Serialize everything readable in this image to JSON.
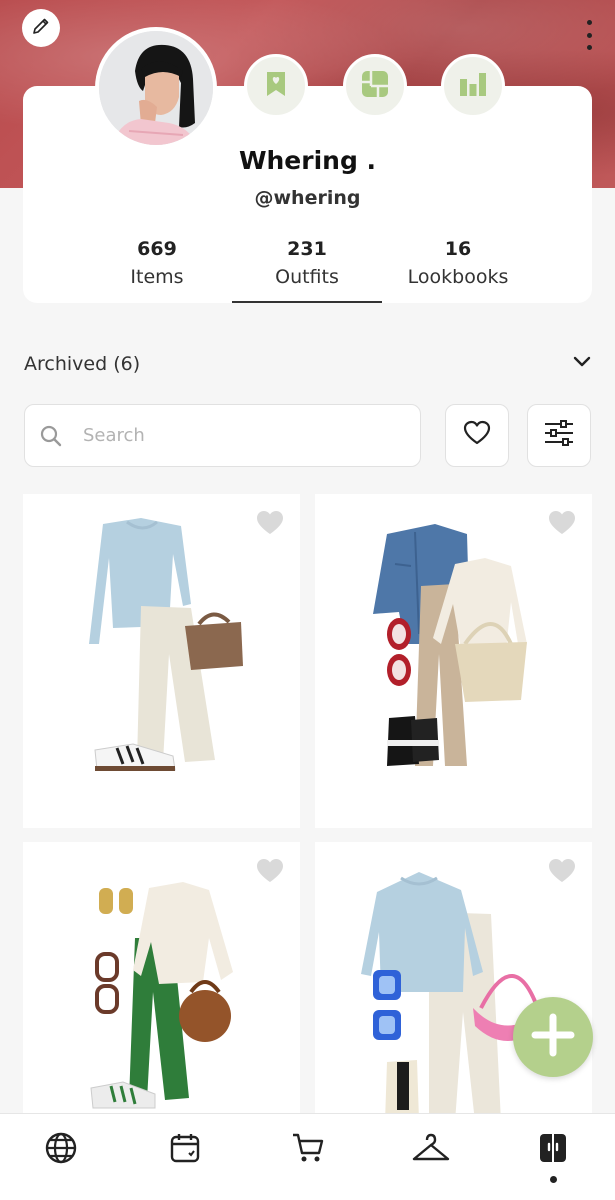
{
  "profile": {
    "name": "Whering  .",
    "handle": "@whering"
  },
  "stats": [
    {
      "count": "669",
      "label": "Items"
    },
    {
      "count": "231",
      "label": "Outfits"
    },
    {
      "count": "16",
      "label": "Lookbooks"
    }
  ],
  "selected_stat": "Outfits",
  "archived": {
    "label": "Archived (6)"
  },
  "search": {
    "placeholder": "Search",
    "value": ""
  },
  "icons": {
    "edit": "pencil-icon",
    "more": "more-vertical-icon",
    "header_buttons": [
      "bookmark-heart-icon",
      "collage-icon",
      "bar-chart-icon"
    ],
    "filter_buttons": [
      "heart-outline-icon",
      "sliders-icon"
    ],
    "nav": [
      "globe-icon",
      "calendar-icon",
      "cart-icon",
      "hanger-icon",
      "wardrobe-icon"
    ],
    "fab": "plus-icon"
  },
  "colors": {
    "banner": "#b84a4c",
    "accent_green": "#b4d08c",
    "header_icon_green": "#a8c97f",
    "heart_grey": "#d9d9d9"
  },
  "active_nav": "wardrobe-icon"
}
